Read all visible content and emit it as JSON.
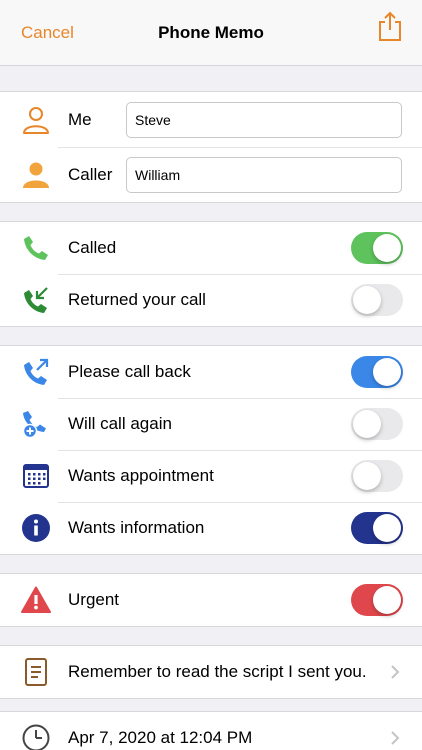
{
  "navbar": {
    "cancel_label": "Cancel",
    "title": "Phone Memo",
    "share_icon": "share-icon"
  },
  "people": {
    "me": {
      "label": "Me",
      "value": "Steve",
      "icon": "person-outline-icon"
    },
    "caller": {
      "label": "Caller",
      "value": "William",
      "icon": "person-filled-icon"
    }
  },
  "calls": {
    "called": {
      "label": "Called",
      "on": true,
      "color": "#5ec35d"
    },
    "returned": {
      "label": "Returned your call",
      "on": false
    }
  },
  "requests": {
    "call_back": {
      "label": "Please call back",
      "on": true,
      "color": "#3a87e8"
    },
    "call_again": {
      "label": "Will call again",
      "on": false
    },
    "appointment": {
      "label": "Wants appointment",
      "on": false
    },
    "information": {
      "label": "Wants information",
      "on": true,
      "color": "#23348f"
    }
  },
  "urgent": {
    "label": "Urgent",
    "on": true,
    "color": "#e0474c"
  },
  "note": {
    "text": "Remember to read the script I sent you."
  },
  "date": {
    "text": "Apr 7, 2020 at 12:04 PM"
  },
  "colors": {
    "accent": "#e8862a",
    "toggle_off": "#e9e9eb"
  }
}
